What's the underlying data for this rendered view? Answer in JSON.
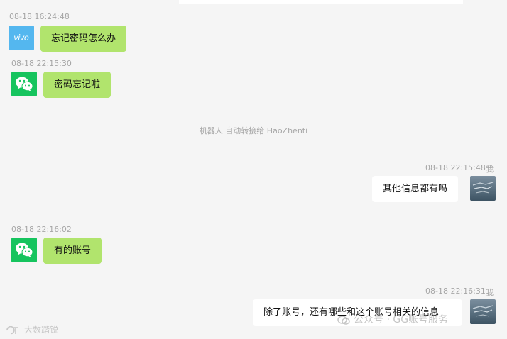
{
  "messages": [
    {
      "side": "left",
      "time": "08-18 16:24:48",
      "avatar_icon": "vivo-logo-icon",
      "avatar_text": "vivo",
      "text": "忘记密码怎么办",
      "bubble_color": "#b1e46d"
    },
    {
      "side": "left",
      "time": "08-18 22:15:30",
      "avatar_icon": "wechat-logo-icon",
      "text": "密码忘记啦",
      "bubble_color": "#b1e46d"
    },
    {
      "side": "right",
      "time": "08-18 22:15:48",
      "sender": "我",
      "avatar_icon": "user-photo-avatar",
      "text": "其他信息都有吗",
      "bubble_color": "#ffffff"
    },
    {
      "side": "left",
      "time": "08-18 22:16:02",
      "avatar_icon": "wechat-logo-icon",
      "text": "有的账号",
      "bubble_color": "#b1e46d"
    },
    {
      "side": "right",
      "time": "08-18 22:16:31",
      "sender": "我",
      "avatar_icon": "user-photo-avatar",
      "text": "除了账号，还有哪些和这个账号相关的信息",
      "bubble_color": "#ffffff"
    }
  ],
  "system_notice": "机器人 自动转接给 HaoZhenti",
  "watermarks": {
    "left": "大数踏锐",
    "right": "公众号 · GG账号服务"
  },
  "colors": {
    "background": "#f5f5f5",
    "customer_bubble": "#b1e46d",
    "agent_bubble": "#ffffff",
    "wechat_green": "#16c45e",
    "vivo_blue": "#54b7ef",
    "timestamp_gray": "#a6a6a6"
  }
}
